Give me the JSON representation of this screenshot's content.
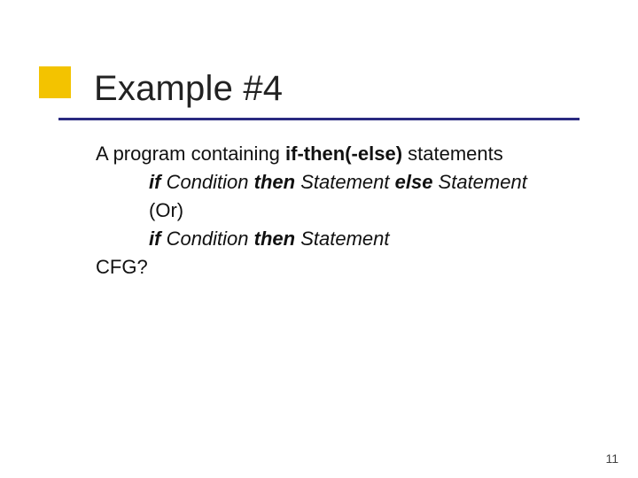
{
  "title": "Example #4",
  "body": {
    "intro_prefix": "A program containing ",
    "intro_bold": "if-then(-else)",
    "intro_suffix": " statements",
    "line1_if": "if",
    "line1_cond": " Condition ",
    "line1_then": "then",
    "line1_stmt1": " Statement ",
    "line1_else": "else",
    "line1_stmt2": " Statement",
    "line2_or": "(Or)",
    "line3_if": "if",
    "line3_cond": " Condition ",
    "line3_then": "then",
    "line3_stmt": " Statement",
    "cfg": "CFG?"
  },
  "page_number": "11"
}
